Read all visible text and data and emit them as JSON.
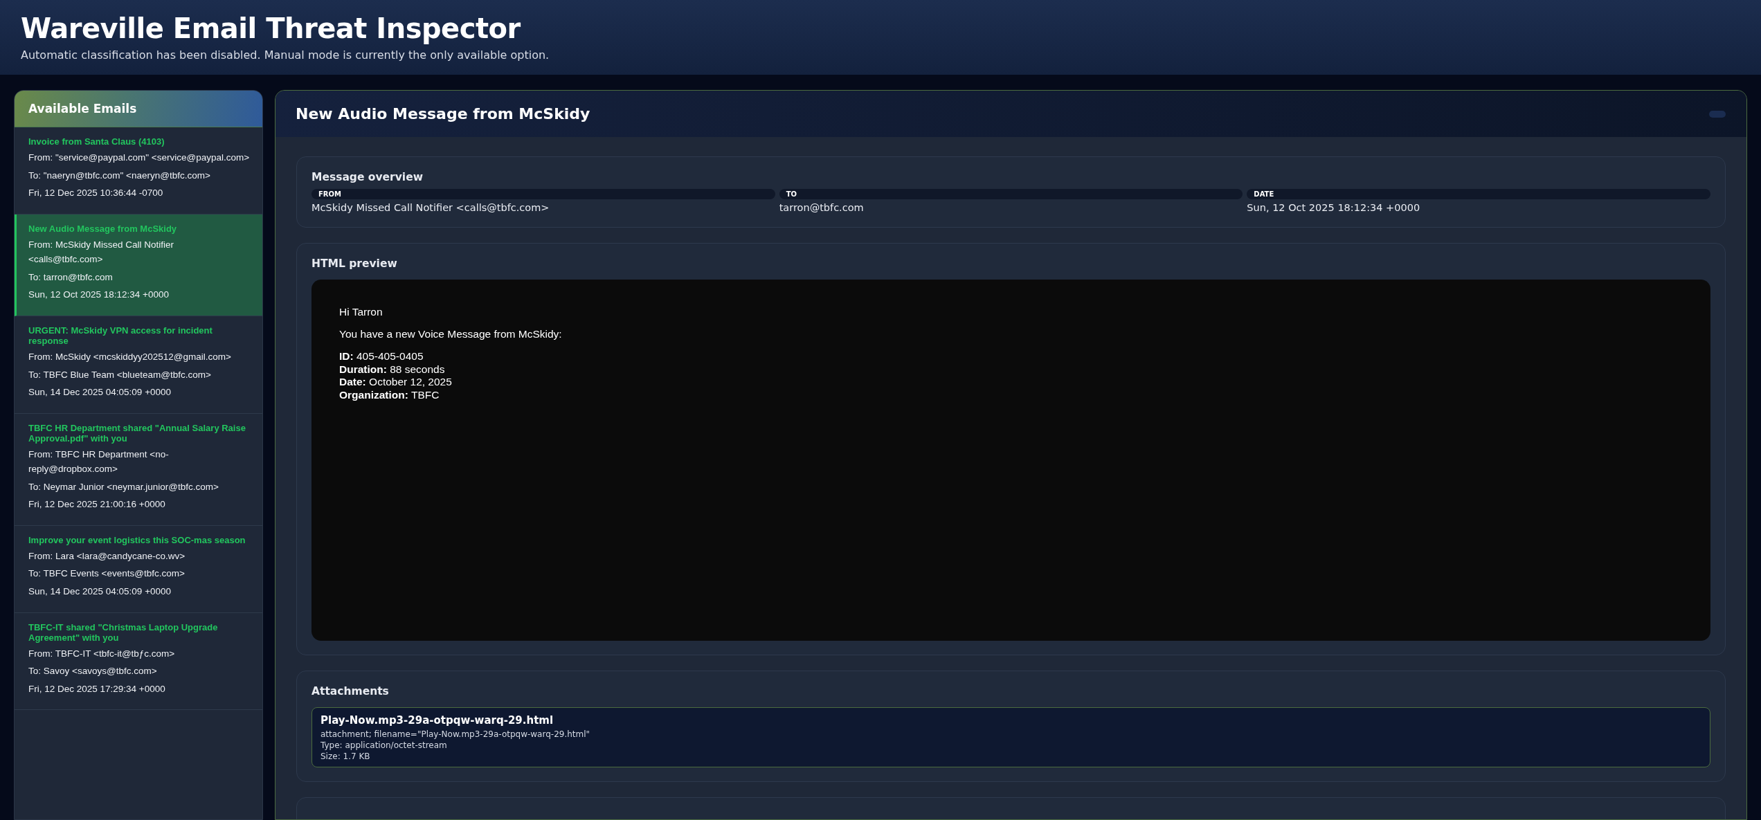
{
  "header": {
    "title": "Wareville Email Threat Inspector",
    "subtitle": "Automatic classification has been disabled. Manual mode is currently the only available option."
  },
  "sidebar": {
    "title": "Available Emails",
    "emails": [
      {
        "subject": "Invoice from Santa Claus (4103)",
        "from": "From: \"service@paypal.com\" <service@paypal.com>",
        "to": "To: \"naeryn@tbfc.com\" <naeryn@tbfc.com>",
        "date": "Fri, 12 Dec 2025 10:36:44 -0700",
        "selected": false
      },
      {
        "subject": "New Audio Message from McSkidy",
        "from": "From: McSkidy Missed Call Notifier <calls@tbfc.com>",
        "to": "To: tarron@tbfc.com",
        "date": "Sun, 12 Oct 2025 18:12:34 +0000",
        "selected": true
      },
      {
        "subject": "URGENT: McSkidy VPN access for incident response",
        "from": "From: McSkidy <mcskiddyy202512@gmail.com>",
        "to": "To: TBFC Blue Team <blueteam@tbfc.com>",
        "date": "Sun, 14 Dec 2025 04:05:09 +0000",
        "selected": false
      },
      {
        "subject": "TBFC HR Department shared \"Annual Salary Raise Approval.pdf\" with you",
        "from": "From: TBFC HR Department <no-reply@dropbox.com>",
        "to": "To: Neymar Junior <neymar.junior@tbfc.com>",
        "date": "Fri, 12 Dec 2025 21:00:16 +0000",
        "selected": false
      },
      {
        "subject": "Improve your event logistics this SOC-mas season",
        "from": "From: Lara <lara@candycane-co.wv>",
        "to": "To: TBFC Events <events@tbfc.com>",
        "date": "Sun, 14 Dec 2025 04:05:09 +0000",
        "selected": false
      },
      {
        "subject": "TBFC-IT shared \"Christmas Laptop Upgrade Agreement\" with you",
        "from": "From: TBFC-IT <tbfc-it@tbƒc.com>",
        "to": "To: Savoy <savoys@tbfc.com>",
        "date": "Fri, 12 Dec 2025 17:29:34 +0000",
        "selected": false
      }
    ]
  },
  "message": {
    "title": "New Audio Message from McSkidy",
    "overview": {
      "title": "Message overview",
      "fields": [
        {
          "label": "FROM",
          "value": "McSkidy Missed Call Notifier <calls@tbfc.com>"
        },
        {
          "label": "TO",
          "value": "tarron@tbfc.com"
        },
        {
          "label": "DATE",
          "value": "Sun, 12 Oct 2025 18:12:34 +0000"
        }
      ]
    },
    "preview": {
      "title": "HTML preview",
      "paragraphs": [
        "Hi Tarron",
        "You have a new Voice Message from McSkidy:"
      ],
      "details": [
        "**ID:** 405-405-0405",
        "**Duration:** 88 seconds",
        "**Date:** October 12, 2025",
        "**Organization:** TBFC"
      ]
    },
    "attachments": {
      "title": "Attachments",
      "items": [
        {
          "name": "Play-Now.mp3-29a-otpqw-warq-29.html",
          "disposition": "attachment; filename=\"Play-Now.mp3-29a-otpqw-warq-29.html\"",
          "type": "Type: application/octet-stream",
          "size": "Size: 1.7 KB"
        }
      ]
    }
  }
}
